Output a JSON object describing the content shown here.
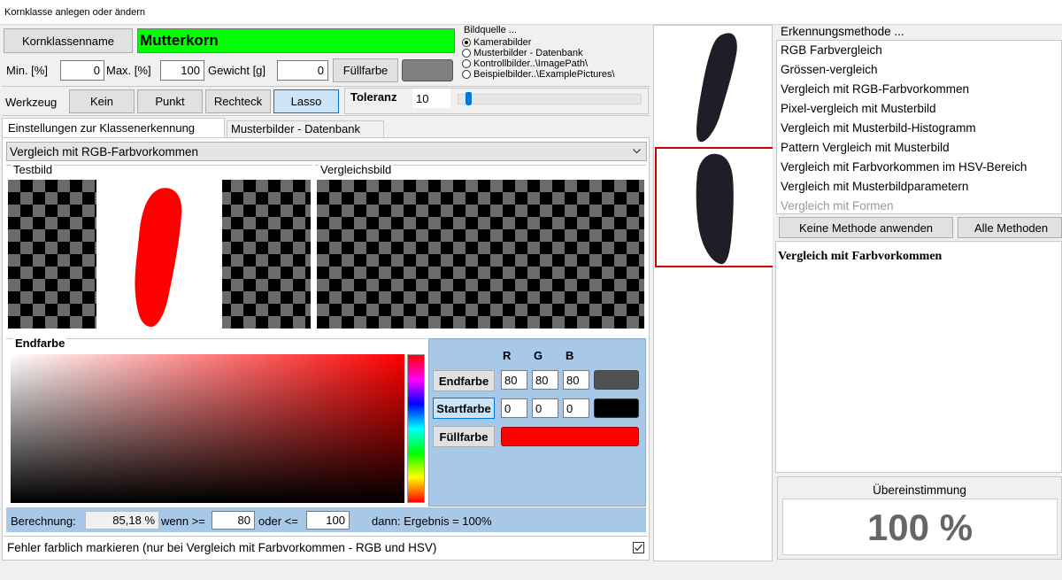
{
  "window": {
    "title": "Kornklasse anlegen oder ändern"
  },
  "header": {
    "name_button": "Kornklassenname",
    "name_value": "Mutterkorn",
    "min_label": "Min. [%]",
    "min_value": "0",
    "max_label": "Max. [%]",
    "max_value": "100",
    "weight_label": "Gewicht [g]",
    "weight_value": "0",
    "fill_button": "Füllfarbe",
    "fill_color": "#808080",
    "name_color": "#00ff00"
  },
  "image_source": {
    "title": "Bildquelle ...",
    "options": [
      {
        "label": "Kamerabilder",
        "selected": true
      },
      {
        "label": "Musterbilder  - Datenbank",
        "selected": false
      },
      {
        "label": "Kontrollbilder..\\ImagePath\\",
        "selected": false
      },
      {
        "label": "Beispielbilder..\\ExamplePictures\\",
        "selected": false
      }
    ]
  },
  "tools": {
    "label": "Werkzeug",
    "buttons": [
      "Kein",
      "Punkt",
      "Rechteck",
      "Lasso"
    ],
    "selected": "Lasso",
    "tolerance_label": "Toleranz",
    "tolerance_value": "10",
    "tolerance_fraction": 0.02
  },
  "tabs": [
    "Einstellungen zur Klassenerkennung",
    "Musterbilder - Datenbank"
  ],
  "method_select": {
    "value": "Vergleich mit RGB-Farbvorkommen"
  },
  "test_image": {
    "label": "Testbild"
  },
  "compare_image": {
    "label": "Vergleichsbild"
  },
  "color_picker": {
    "label": "Endfarbe",
    "rgb_headers": [
      "R",
      "G",
      "B"
    ],
    "end_button": "Endfarbe",
    "end_rgb": [
      "80",
      "80",
      "80"
    ],
    "end_color": "#505050",
    "start_button": "Startfarbe",
    "start_rgb": [
      "0",
      "0",
      "0"
    ],
    "start_color": "#000000",
    "fill_button": "Füllfarbe",
    "fill_color": "#ff0000"
  },
  "calculation": {
    "label": "Berechnung:",
    "value": "85,18 %",
    "when_label": "wenn >=",
    "when_value": "80",
    "or_label": "oder <=",
    "or_value": "100",
    "result_text": "dann: Ergebnis = 100%"
  },
  "error_mark": {
    "label": "Fehler farblich markieren (nur bei Vergleich mit Farbvorkommen - RGB und HSV)",
    "checked": true
  },
  "methods": {
    "title": "Erkennungsmethode ...",
    "items": [
      "RGB Farbvergleich",
      "Grössen-vergleich",
      "Vergleich mit RGB-Farbvorkommen",
      "Pixel-vergleich mit Musterbild",
      "Vergleich mit Musterbild-Histogramm",
      "Pattern Vergleich mit Musterbild",
      "Vergleich mit Farbvorkommen im HSV-Bereich",
      "Vergleich mit Musterbildparametern",
      "Vergleich mit Formen"
    ],
    "no_method_button": "Keine Methode anwenden",
    "all_methods_button": "Alle Methoden",
    "description": "Vergleich mit Farbvorkommen"
  },
  "match": {
    "title": "Übereinstimmung",
    "value": "100 %"
  },
  "colors": {
    "selection_border": "#cc0000",
    "calc_bar": "#a8c8e8",
    "grain": "#1e1e28"
  }
}
